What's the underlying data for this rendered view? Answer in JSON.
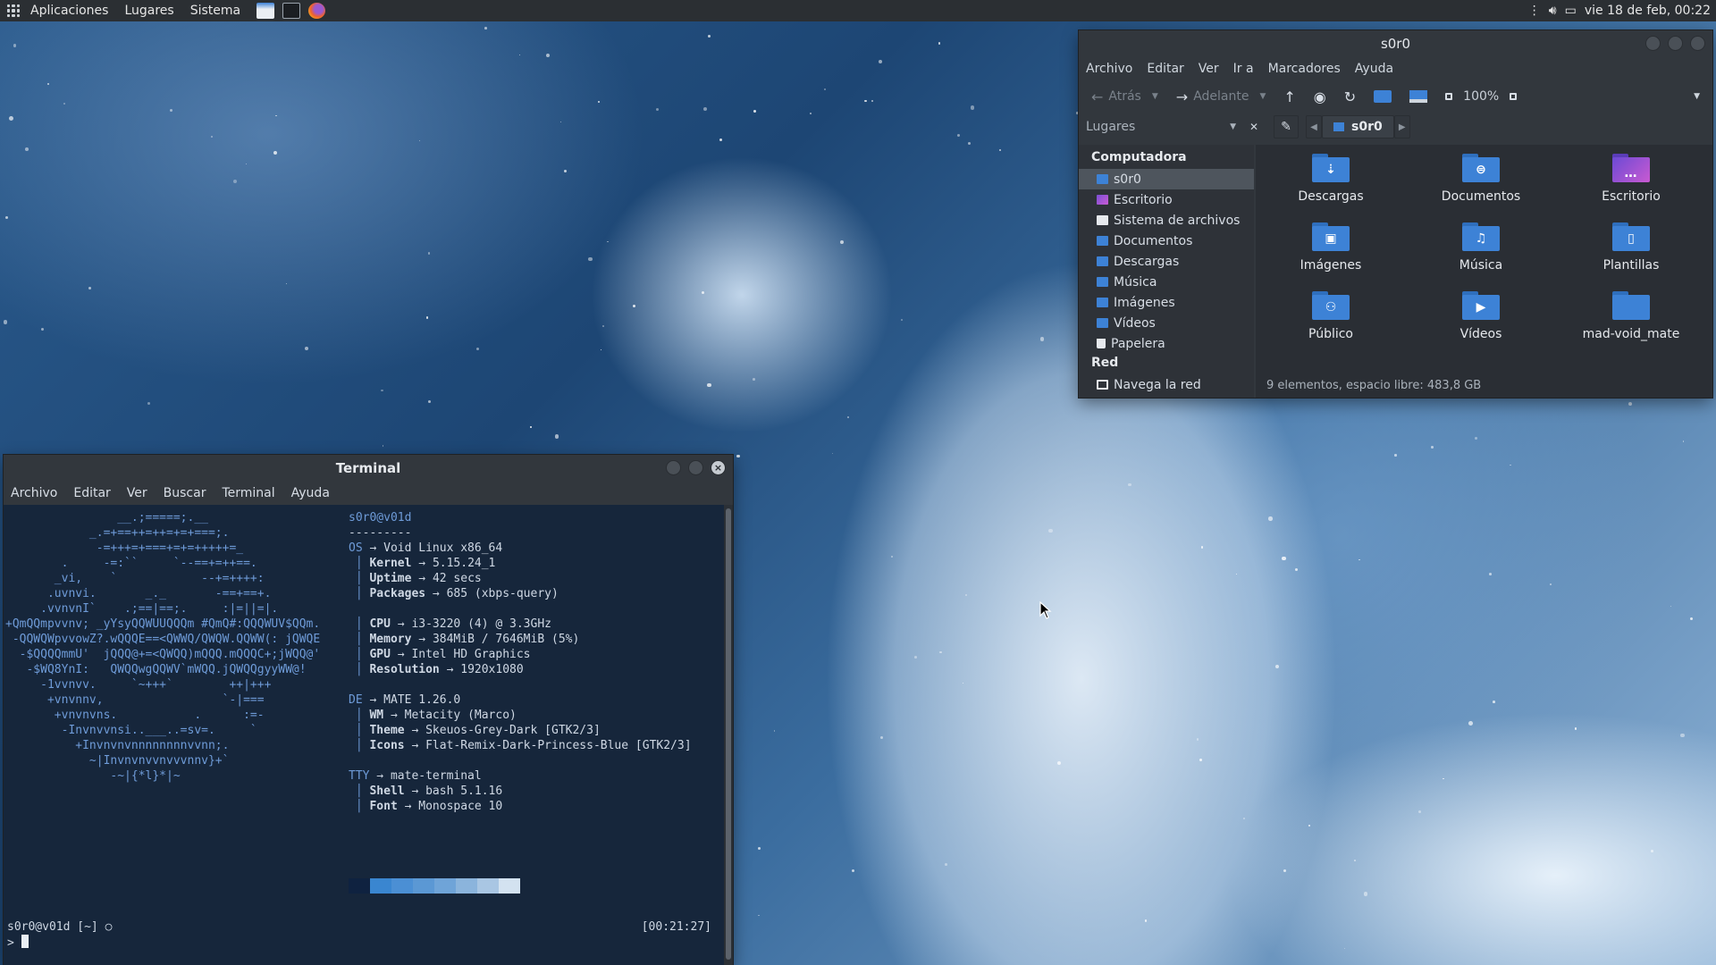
{
  "top_panel": {
    "menus": [
      "Aplicaciones",
      "Lugares",
      "Sistema"
    ],
    "clock": "vie 18 de feb, 00:22"
  },
  "terminal": {
    "title": "Terminal",
    "menu": [
      "Archivo",
      "Editar",
      "Ver",
      "Buscar",
      "Terminal",
      "Ayuda"
    ],
    "ascii_art": [
      "                __.;=====;.__",
      "            _.=+==++=++=+=+===;.",
      "             -=+++=+===+=+=+++++=_",
      "        .     -=:``     `--==+=++==.",
      "       _vi,    `            --+=++++:",
      "      .uvnvi.       _._       -==+==+.",
      "     .vvnvnI`    .;==|==;.     :|=||=|.",
      "+QmQQmpvvnv; _yYsyQQWUUQQQm #QmQ#:QQQWUV$QQm.",
      " -QQWQWpvvowZ?.wQQQE==<QWWQ/QWQW.QQWW(: jQWQE",
      "  -$QQQQmmU'  jQQQ@+=<QWQQ)mQQQ.mQQQC+;jWQQ@'",
      "   -$WQ8YnI:   QWQQwgQQWV`mWQQ.jQWQQgyyWW@!",
      "     -1vvnvv.     `~+++`        ++|+++",
      "      +vnvnnv,                 `-|===",
      "       +vnvnvns.           .      :=-",
      "        -Invnvvnsi..___..=sv=.     `",
      "          +Invnvnvnnnnnnnnvvnn;.",
      "            ~|Invnvnvvnvvvnnv}+`",
      "               -~|{*l}*|~"
    ],
    "info": {
      "userhost": "s0r0@v01d",
      "separator": "---------",
      "rows": [
        {
          "key": "OS",
          "value": "Void Linux x86_64",
          "level": 0
        },
        {
          "key": "Kernel",
          "value": "5.15.24_1",
          "level": 1
        },
        {
          "key": "Uptime",
          "value": "42 secs",
          "level": 1
        },
        {
          "key": "Packages",
          "value": "685 (xbps-query)",
          "level": 1
        },
        {
          "key": "",
          "value": "",
          "level": -1
        },
        {
          "key": "CPU",
          "value": "i3-3220 (4) @ 3.3GHz",
          "level": 1
        },
        {
          "key": "Memory",
          "value": "384MiB / 7646MiB (5%)",
          "level": 1
        },
        {
          "key": "GPU",
          "value": "Intel HD Graphics",
          "level": 1
        },
        {
          "key": "Resolution",
          "value": "1920x1080",
          "level": 1
        },
        {
          "key": "",
          "value": "",
          "level": -1
        },
        {
          "key": "DE",
          "value": "MATE 1.26.0",
          "level": 0
        },
        {
          "key": "WM",
          "value": "Metacity (Marco)",
          "level": 1
        },
        {
          "key": "Theme",
          "value": "Skeuos-Grey-Dark [GTK2/3]",
          "level": 1
        },
        {
          "key": "Icons",
          "value": "Flat-Remix-Dark-Princess-Blue [GTK2/3]",
          "level": 1
        },
        {
          "key": "",
          "value": "",
          "level": -1
        },
        {
          "key": "TTY",
          "value": "mate-terminal",
          "level": 0
        },
        {
          "key": "Shell",
          "value": "bash 5.1.16",
          "level": 1
        },
        {
          "key": "Font",
          "value": "Monospace 10",
          "level": 1
        }
      ],
      "arrow": "→"
    },
    "swatch_colors": [
      "#0f2240",
      "#3a86d0",
      "#4b8fd4",
      "#5b98d4",
      "#6fa4d8",
      "#8bb4dc",
      "#a9c6e3",
      "#d3e2f0"
    ],
    "prompt": "s0r0@v01d [~] ○",
    "prompt_time": "[00:21:27]",
    "prompt_symbol": ">"
  },
  "file_manager": {
    "title": "s0r0",
    "menu": [
      "Archivo",
      "Editar",
      "Ver",
      "Ir a",
      "Marcadores",
      "Ayuda"
    ],
    "toolbar": {
      "back": "Atrás",
      "forward": "Adelante",
      "zoom": "100%"
    },
    "places_label": "Lugares",
    "path_crumb": "s0r0",
    "sidebar": {
      "section_computer": "Computadora",
      "computer_items": [
        "s0r0",
        "Escritorio",
        "Sistema de archivos",
        "Documentos",
        "Descargas",
        "Música",
        "Imágenes",
        "Vídeos",
        "Papelera"
      ],
      "section_network": "Red",
      "network_items": [
        "Navega la red"
      ]
    },
    "items": [
      {
        "name": "Descargas",
        "glyph": "⇣"
      },
      {
        "name": "Documentos",
        "glyph": "⊜"
      },
      {
        "name": "Escritorio",
        "glyph": "…"
      },
      {
        "name": "Imágenes",
        "glyph": "▣"
      },
      {
        "name": "Música",
        "glyph": "♫"
      },
      {
        "name": "Plantillas",
        "glyph": "▯"
      },
      {
        "name": "Público",
        "glyph": "⚇"
      },
      {
        "name": "Vídeos",
        "glyph": "▶"
      },
      {
        "name": "mad-void_mate",
        "glyph": ""
      }
    ],
    "status": "9 elementos, espacio libre: 483,8 GB"
  }
}
